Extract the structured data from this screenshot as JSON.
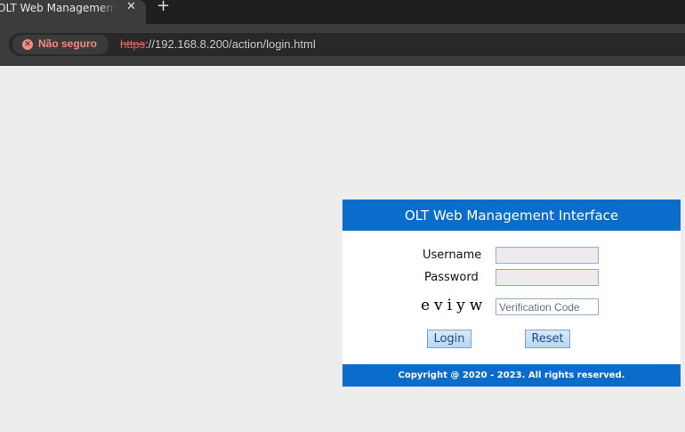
{
  "browser": {
    "tab": {
      "title": "OLT Web Management Interface",
      "close_glyph": "✕"
    },
    "new_tab_glyph": "+",
    "security": {
      "label": "Não seguro",
      "icon": "warning-x-icon",
      "color": "#f28b82"
    },
    "url": {
      "scheme": "https",
      "rest": "://192.168.8.200/action/login.html"
    }
  },
  "login": {
    "header": "OLT Web Management Interface",
    "username_label": "Username",
    "password_label": "Password",
    "username_value": "",
    "password_value": "",
    "captcha_text": "eviyw",
    "code_placeholder": "Verification Code",
    "login_button": "Login",
    "reset_button": "Reset",
    "footer": "Copyright @ 2020 - 2023. All rights reserved."
  },
  "colors": {
    "accent": "#0b6dcb",
    "page_background": "#ededed",
    "button_text": "#1b4d86"
  }
}
